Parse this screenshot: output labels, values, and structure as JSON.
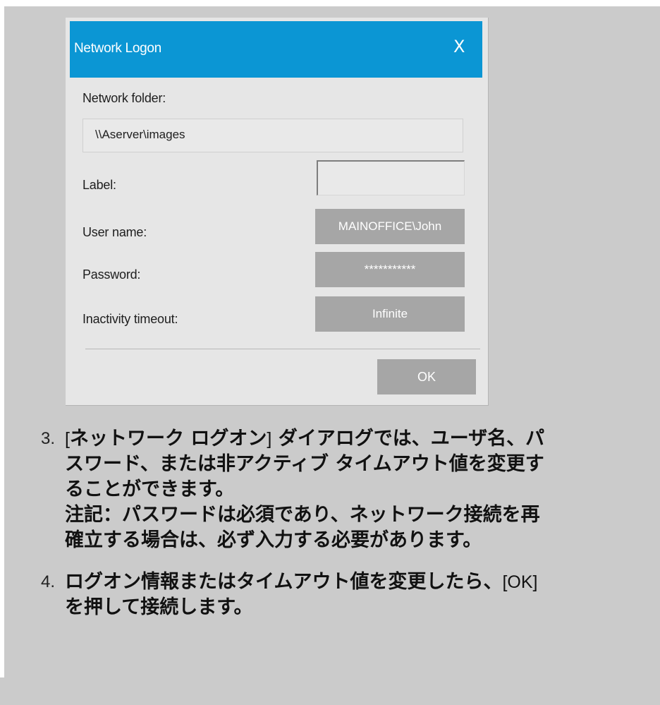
{
  "dialog": {
    "title": "Network Logon",
    "close_glyph": "X",
    "network_folder_label": "Network folder:",
    "network_folder_value": "\\\\Aserver\\images",
    "label_label": "Label:",
    "label_value": "",
    "user_name_label": "User name:",
    "user_name_value": "MAINOFFICE\\John",
    "password_label": "Password:",
    "password_value": "***********",
    "inactivity_timeout_label": "Inactivity timeout:",
    "inactivity_timeout_value": "Infinite",
    "ok_label": "OK"
  },
  "colors": {
    "titlebar": "#0b96d4",
    "panel_background": "#cbcbcb",
    "dialog_background": "#e6e6e6",
    "field_button": "#a6a6a6"
  },
  "icons": {
    "close": "close-icon"
  },
  "instructions": [
    {
      "number": "3.",
      "bracket_open": "[",
      "line1_bold": "ネットワーク ログオン",
      "bracket_close": "]",
      "line1_rest": " ダイアログでは、ユーザ名、パ",
      "line2": "スワード、または非アクティブ タイムアウト値を変更す",
      "line3": "ることができます。",
      "line4": "注記：パスワードは必須であり、ネットワーク接続を再",
      "line5": "確立する場合は、必ず入力する必要があります。"
    },
    {
      "number": "4.",
      "line1_bold": "ログオン情報またはタイムアウト値を変更したら、",
      "line1_plain": "[OK]",
      "line2": "を押して接続します。"
    }
  ]
}
